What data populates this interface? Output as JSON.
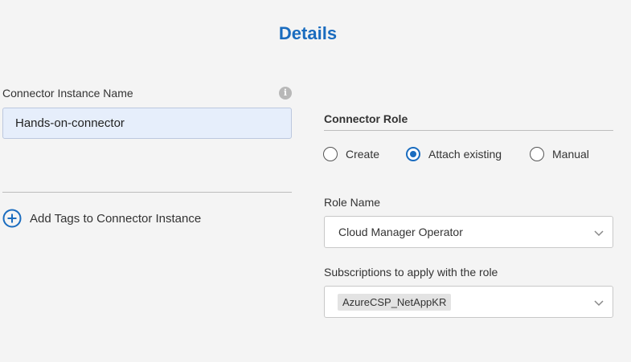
{
  "page": {
    "title": "Details"
  },
  "instance": {
    "label": "Connector Instance Name",
    "value": "Hands-on-connector",
    "info_icon": "info-icon"
  },
  "tags": {
    "label": "Add Tags to Connector Instance",
    "icon": "plus-circle-icon"
  },
  "role": {
    "heading": "Connector Role",
    "options": [
      {
        "label": "Create",
        "selected": false
      },
      {
        "label": "Attach existing",
        "selected": true
      },
      {
        "label": "Manual",
        "selected": false
      }
    ],
    "name_label": "Role Name",
    "name_value": "Cloud Manager Operator",
    "subs_label": "Subscriptions to apply with the role",
    "subs_chip": "AzureCSP_NetAppKR"
  },
  "colors": {
    "accent": "#1a6cbf",
    "input_bg": "#e6eefb",
    "page_bg": "#f4f4f4"
  }
}
